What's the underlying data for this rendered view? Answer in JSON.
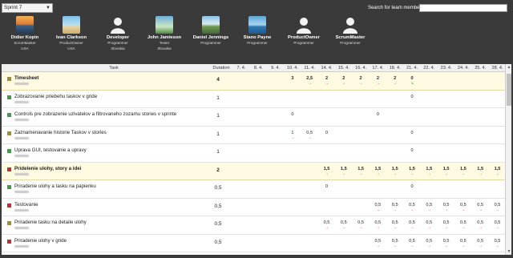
{
  "header": {
    "sprint": "Sprint 7",
    "search_label": "Search for team member",
    "search_value": "",
    "members": [
      {
        "name": "Didier Kopin",
        "role": "ScrumMaster",
        "country": "USA",
        "avatar": "photo-sunset"
      },
      {
        "name": "Ivan Clarkson",
        "role": "ProductOwner",
        "country": "USA",
        "avatar": "photo-beach"
      },
      {
        "name": "Developer",
        "role": "Programmer",
        "country": "Slovakia",
        "avatar": "default-person"
      },
      {
        "name": "John Jamieson",
        "role": "Tester",
        "country": "Slovakia",
        "avatar": "photo-palm"
      },
      {
        "name": "Daniel Jennings",
        "role": "Programmer",
        "country": "",
        "avatar": "photo-landscape"
      },
      {
        "name": "Stano Payne",
        "role": "Programmer",
        "country": "",
        "avatar": "photo-sea"
      },
      {
        "name": "ProductOwner",
        "role": "Programmer",
        "country": "",
        "avatar": "default-person"
      },
      {
        "name": "ScrumMaster",
        "role": "Programmer",
        "country": "",
        "avatar": "default-person"
      }
    ]
  },
  "grid": {
    "col_task": "Task",
    "col_duration": "Duration",
    "dates": [
      "7. 4.",
      "8. 4.",
      "9. 4.",
      "10. 4.",
      "11. 4.",
      "14. 4.",
      "15. 4.",
      "16. 4.",
      "17. 4.",
      "18. 4.",
      "21. 4.",
      "22. 4.",
      "23. 4.",
      "24. 4.",
      "25. 4.",
      "28. 4."
    ],
    "rows": [
      {
        "type": "story",
        "color": "#a08a40",
        "name": "Timesheet",
        "duration": "4",
        "cells": [
          "",
          "",
          "",
          "3",
          "2,5",
          "2",
          "2",
          "2",
          "2",
          "2",
          "0",
          "",
          "",
          "",
          "",
          ""
        ],
        "arrows": [
          "",
          "",
          "",
          "",
          "red",
          "red",
          "red",
          "red",
          "red",
          "red",
          "green",
          "",
          "",
          "",
          "",
          ""
        ]
      },
      {
        "type": "task",
        "color": "#3aa040",
        "name": "Zobrazovanie priebehu taskov v gride",
        "duration": "1",
        "cells": [
          "",
          "",
          "",
          "",
          "",
          "",
          "",
          "",
          "",
          "",
          "0",
          "",
          "",
          "",
          "",
          ""
        ],
        "arrows": [
          "",
          "",
          "",
          "",
          "",
          "",
          "",
          "",
          "",
          "",
          "",
          "",
          "",
          "",
          "",
          ""
        ]
      },
      {
        "type": "task",
        "color": "#3aa040",
        "name": "Controls pre zobrazenie uzivatelov a filtrovaneho zozamu stories v sprinte",
        "duration": "1",
        "cells": [
          "",
          "",
          "",
          "0",
          "",
          "",
          "",
          "",
          "0",
          "",
          "",
          "",
          "",
          "",
          "",
          ""
        ],
        "arrows": [
          "",
          "",
          "",
          "",
          "",
          "",
          "",
          "",
          "",
          "",
          "",
          "",
          "",
          "",
          "",
          ""
        ]
      },
      {
        "type": "task",
        "color": "#a08a40",
        "name": "Zaznamenavanie historie Taskov v stories",
        "duration": "1",
        "cells": [
          "",
          "",
          "",
          "1",
          "0,5",
          "0",
          "",
          "",
          "",
          "",
          "0",
          "",
          "",
          "",
          "",
          ""
        ],
        "arrows": [
          "",
          "",
          "",
          "red",
          "red",
          "",
          "",
          "",
          "",
          "",
          "",
          "",
          "",
          "",
          "",
          ""
        ]
      },
      {
        "type": "task",
        "color": "#3aa040",
        "name": "Uprava GUI, testovanie a upravy",
        "duration": "1",
        "cells": [
          "",
          "",
          "",
          "",
          "",
          "",
          "",
          "",
          "",
          "",
          "0",
          "",
          "",
          "",
          "",
          ""
        ],
        "arrows": [
          "",
          "",
          "",
          "",
          "",
          "",
          "",
          "",
          "",
          "",
          "",
          "",
          "",
          "",
          "",
          ""
        ]
      },
      {
        "type": "story",
        "color": "#c03030",
        "name": "Pridelenie ulohy, story a idei",
        "duration": "2",
        "cells": [
          "",
          "",
          "",
          "",
          "",
          "1,5",
          "1,5",
          "1,5",
          "1,5",
          "1,5",
          "1,5",
          "1,5",
          "1,5",
          "1,5",
          "1,5",
          "1,5"
        ],
        "arrows": [
          "",
          "",
          "",
          "",
          "",
          "red",
          "red",
          "red",
          "red",
          "red",
          "red",
          "red",
          "red",
          "red",
          "red",
          "red"
        ]
      },
      {
        "type": "task",
        "color": "#3aa040",
        "name": "Priradenie ulohy a tasku na papienku",
        "duration": "0,5",
        "cells": [
          "",
          "",
          "",
          "",
          "",
          "0",
          "",
          "",
          "",
          "",
          "0",
          "",
          "",
          "",
          "",
          ""
        ],
        "arrows": [
          "",
          "",
          "",
          "",
          "",
          "",
          "",
          "",
          "",
          "",
          "",
          "",
          "",
          "",
          "",
          ""
        ]
      },
      {
        "type": "task",
        "color": "#c03030",
        "name": "Testovanie",
        "duration": "0,5",
        "cells": [
          "",
          "",
          "",
          "",
          "",
          "",
          "",
          "",
          "0,5",
          "0,5",
          "0,5",
          "0,5",
          "0,5",
          "0,5",
          "0,5",
          "0,5"
        ],
        "arrows": [
          "",
          "",
          "",
          "",
          "",
          "",
          "",
          "",
          "red",
          "red",
          "red",
          "red",
          "red",
          "red",
          "red",
          "red"
        ]
      },
      {
        "type": "task",
        "color": "#a08a40",
        "name": "Priradenie tasku na detaile ulohy",
        "duration": "0,5",
        "cells": [
          "",
          "",
          "",
          "",
          "",
          "0,5",
          "0,5",
          "0,5",
          "0,5",
          "0,5",
          "0,5",
          "0,5",
          "0,5",
          "0,5",
          "0,5",
          "0,5"
        ],
        "arrows": [
          "",
          "",
          "",
          "",
          "",
          "red",
          "red",
          "red",
          "red",
          "red",
          "red",
          "red",
          "red",
          "red",
          "red",
          "red"
        ]
      },
      {
        "type": "task",
        "color": "#c03030",
        "name": "Priradenie ulohy v gride",
        "duration": "0,5",
        "cells": [
          "",
          "",
          "",
          "",
          "",
          "",
          "",
          "",
          "0,5",
          "0,5",
          "0,5",
          "0,5",
          "0,5",
          "0,5",
          "0,5",
          "0,5"
        ],
        "arrows": [
          "",
          "",
          "",
          "",
          "",
          "",
          "",
          "",
          "red",
          "red",
          "red",
          "red",
          "red",
          "red",
          "red",
          "red"
        ]
      }
    ]
  }
}
